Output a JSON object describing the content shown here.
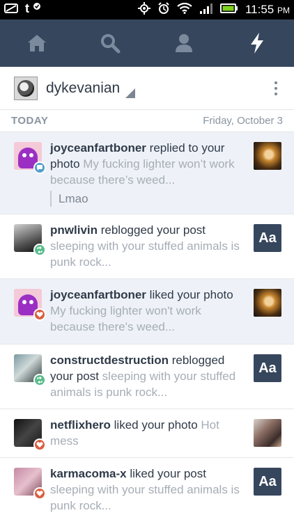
{
  "status_bar": {
    "time": "11:55",
    "ampm": "PM"
  },
  "nav": {
    "items": [
      {
        "icon": "home-icon"
      },
      {
        "icon": "search-icon"
      },
      {
        "icon": "account-icon"
      },
      {
        "icon": "activity-icon",
        "active": true
      }
    ]
  },
  "blog": {
    "name": "dykevanian"
  },
  "section": {
    "title": "TODAY",
    "date": "Friday, October 3"
  },
  "notifications": [
    {
      "username": "joyceanfartboner",
      "action": "replied to your",
      "target": "photo",
      "excerpt": "My fucking lighter won’t work because there’s weed...",
      "reply": "Lmao",
      "badge": "reply",
      "unread": true
    },
    {
      "username": "pnwlivin",
      "action": "reblogged your post",
      "excerpt": "sleeping with your stuffed animals is punk rock...",
      "thumb_text": "Aa",
      "badge": "reblog"
    },
    {
      "username": "joyceanfartboner",
      "action": "liked your",
      "target": "photo",
      "excerpt": "My fucking lighter won't work because there's weed...",
      "badge": "like",
      "unread": true
    },
    {
      "username": "constructdestruction",
      "action": "reblogged",
      "target": "your post",
      "excerpt": "sleeping with your stuffed animals is punk rock...",
      "thumb_text": "Aa",
      "badge": "reblog"
    },
    {
      "username": "netflixhero",
      "action": "liked your photo",
      "excerpt": "Hot mess",
      "badge": "like"
    },
    {
      "username": "karmacoma-x",
      "action": "liked your post",
      "excerpt": "sleeping with your stuffed animals is punk rock...",
      "thumb_text": "Aa",
      "badge": "like"
    }
  ]
}
